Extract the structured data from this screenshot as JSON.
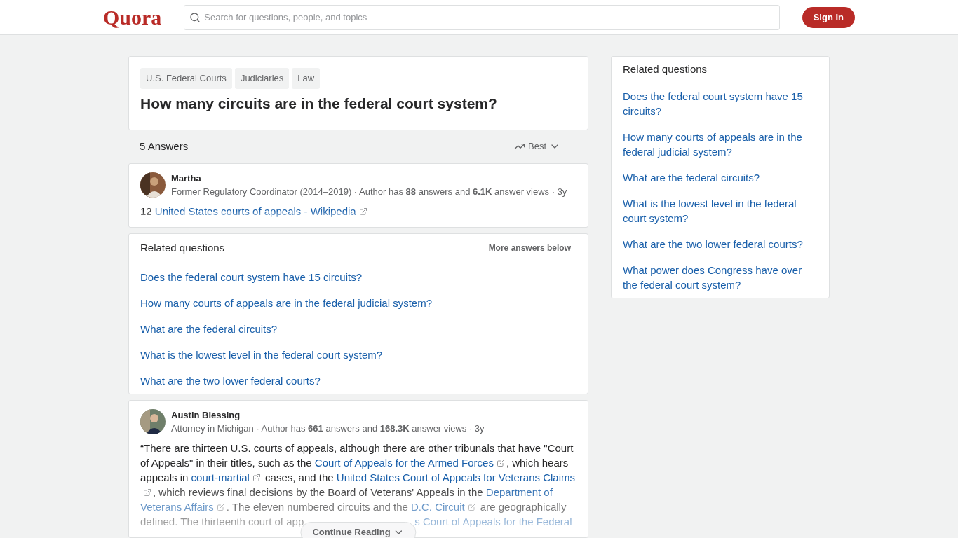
{
  "header": {
    "logo": "Quora",
    "search": {
      "placeholder": "Search for questions, people, and topics"
    },
    "sign_in": "Sign In"
  },
  "question": {
    "topics": [
      "U.S. Federal Courts",
      "Judiciaries",
      "Law"
    ],
    "title": "How many circuits are in the federal court system?"
  },
  "answers_bar": {
    "count": "5 Answers",
    "sort": "Best"
  },
  "answers": [
    {
      "author": "Martha",
      "credential": "Former Regulatory Coordinator (2014–2019) · Author has **88** answers and **6.1K** answer views · 3y",
      "body": [
        {
          "kind": "text",
          "text": "12 "
        },
        {
          "kind": "link",
          "text": "United States courts of appeals - Wikipedia"
        }
      ]
    },
    {
      "author": "Austin Blessing",
      "credential": "Attorney in Michigan · Author has **661** answers and **168.3K** answer views · 3y",
      "body": [
        {
          "kind": "text",
          "text": "“There are thirteen U.S. courts of appeals, although there are other tribunals that have \"Court of Appeals\" in their titles, such as the "
        },
        {
          "kind": "link",
          "text": "Court of Appeals for the Armed Forces"
        },
        {
          "kind": "text",
          "text": ", which hears appeals in "
        },
        {
          "kind": "link",
          "text": "court-martial"
        },
        {
          "kind": "text",
          "text": " cases, and the "
        },
        {
          "kind": "link",
          "text": "United States Court of Appeals for Veterans Claims"
        },
        {
          "kind": "text",
          "text": ", which reviews final decisions by the Board of Veterans' Appeals in the "
        },
        {
          "kind": "link_plain",
          "text": "Department of"
        },
        {
          "kind": "space"
        },
        {
          "kind": "link",
          "text": "Veterans Affairs"
        },
        {
          "kind": "text",
          "text": ". The eleven numbered circuits and the "
        },
        {
          "kind": "link",
          "text": "D.C. Circuit"
        },
        {
          "kind": "text",
          "text": " are geographically defined. The thirteenth court of app"
        },
        {
          "kind": "gap"
        },
        {
          "kind": "link_plain",
          "text": "s Court of Appeals for the Federal"
        }
      ],
      "continue": "Continue Reading"
    }
  ],
  "related_inline": {
    "title": "Related questions",
    "note": "More answers below",
    "items": [
      "Does the federal court system have 15 circuits?",
      "How many courts of appeals are in the federal judicial system?",
      "What are the federal circuits?",
      "What is the lowest level in the federal court system?",
      "What are the two lower federal courts?"
    ]
  },
  "related_sidebar": {
    "title": "Related questions",
    "items": [
      "Does the federal court system have 15 circuits?",
      "How many courts of appeals are in the federal judicial system?",
      "What are the federal circuits?",
      "What is the lowest level in the federal court system?",
      "What are the two lower federal courts?",
      "What power does Congress have over the federal court system?"
    ]
  }
}
